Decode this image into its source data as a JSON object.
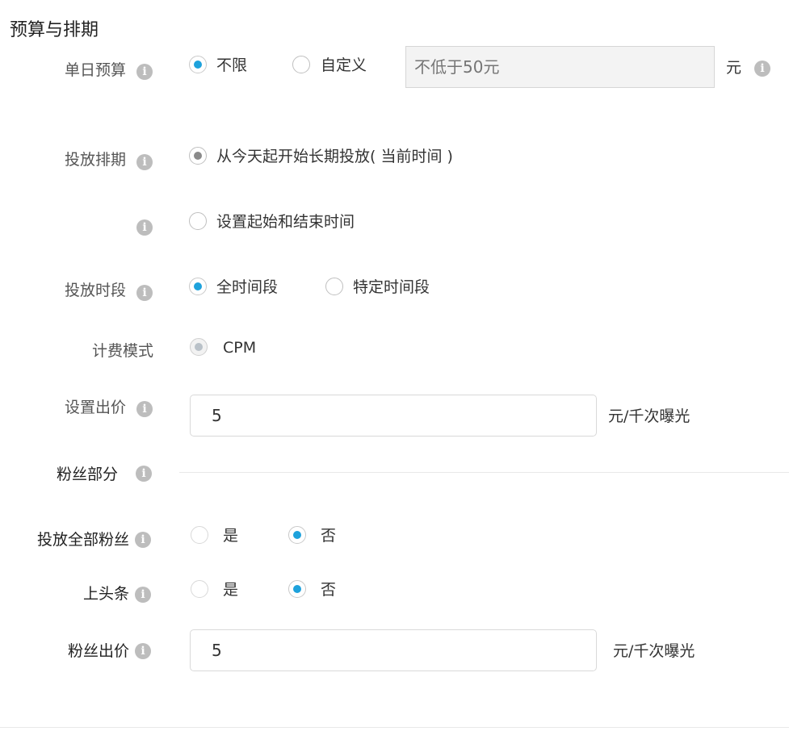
{
  "section_title": "预算与排期",
  "daily_budget": {
    "label": "单日预算",
    "option_unlimited": "不限",
    "option_custom": "自定义",
    "input_placeholder": "不低于50元",
    "unit": "元"
  },
  "schedule": {
    "label": "投放排期",
    "option_long_term": "从今天起开始长期投放( 当前时间 )",
    "option_range": "设置起始和结束时间"
  },
  "time_slot": {
    "label": "投放时段",
    "option_all": "全时间段",
    "option_specific": "特定时间段"
  },
  "billing": {
    "label": "计费模式",
    "option": "CPM"
  },
  "bid": {
    "label": "设置出价",
    "value": "5",
    "unit": "元/千次曝光"
  },
  "fans_section": {
    "label": "粉丝部分"
  },
  "all_fans": {
    "label": "投放全部粉丝",
    "option_yes": "是",
    "option_no": "否"
  },
  "headline": {
    "label": "上头条",
    "option_yes": "是",
    "option_no": "否"
  },
  "fans_bid": {
    "label": "粉丝出价",
    "value": "5",
    "unit": "元/千次曝光"
  },
  "icons": {
    "info": "i"
  },
  "colors": {
    "accent": "#1ea2dc",
    "info_icon": "#bdbdbd",
    "disabled_input": "#f3f3f3"
  }
}
